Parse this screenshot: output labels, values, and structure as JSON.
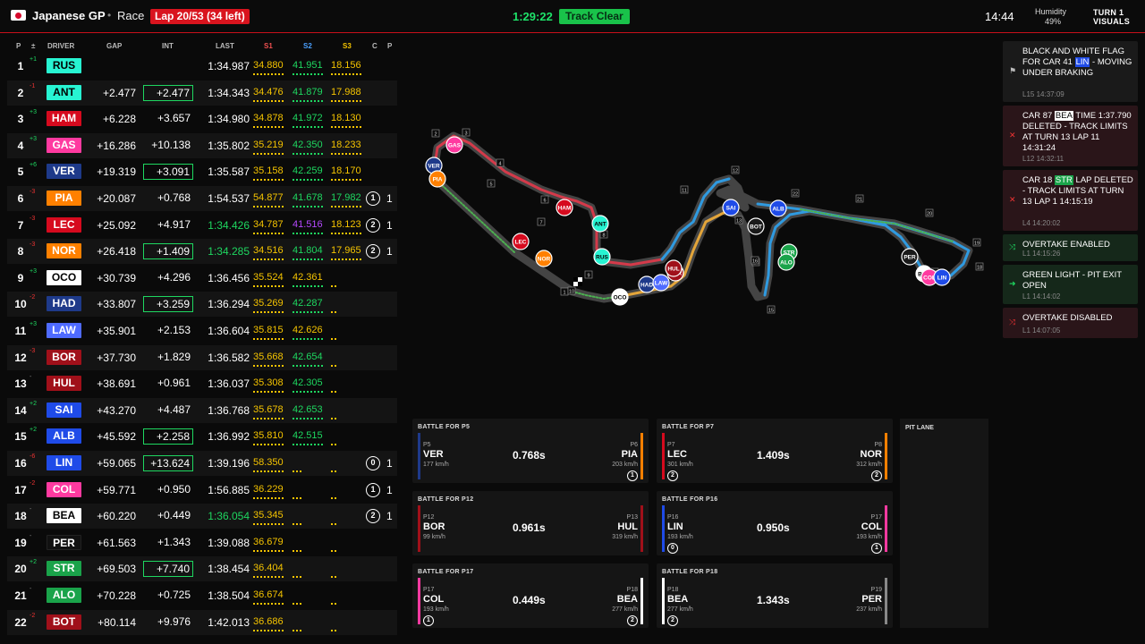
{
  "header": {
    "gp": "Japanese GP",
    "session": "Race",
    "lap": "Lap 20/53 (34 left)",
    "clock": "1:29:22",
    "track_status": "Track Clear",
    "local_time": "14:44",
    "humidity_label": "Humidity",
    "humidity_value": "49%",
    "brand_line1": "TURN 1",
    "brand_line2": "VISUALS"
  },
  "tower_headers": {
    "p": "P",
    "chg": "±",
    "driver": "DRIVER",
    "gap": "GAP",
    "int": "INT",
    "last": "LAST",
    "s1": "S1",
    "s2": "S2",
    "s3": "S3",
    "c": "C",
    "pit": "P"
  },
  "drivers": [
    {
      "pos": "1",
      "chg": "+1",
      "code": "RUS",
      "color": "#27f4d2",
      "text": "#000",
      "gap": "",
      "int": "",
      "int_box": false,
      "last": "1:34.987",
      "last_color": "#fff",
      "s1": "34.880",
      "s2": "41.951",
      "s3": "18.156",
      "s1c": "#f5c400",
      "s2c": "#1ed760",
      "s3c": "#f5c400",
      "pit": "",
      "pitc": ""
    },
    {
      "pos": "2",
      "chg": "-1",
      "code": "ANT",
      "color": "#27f4d2",
      "text": "#000",
      "gap": "+2.477",
      "int": "+2.477",
      "int_box": true,
      "last": "1:34.343",
      "last_color": "#fff",
      "s1": "34.476",
      "s2": "41.879",
      "s3": "17.988",
      "s1c": "#f5c400",
      "s2c": "#1ed760",
      "s3c": "#f5c400",
      "pit": "",
      "pitc": ""
    },
    {
      "pos": "3",
      "chg": "+3",
      "code": "HAM",
      "color": "#d60a1e",
      "text": "#fff",
      "gap": "+6.228",
      "int": "+3.657",
      "int_box": false,
      "last": "1:34.980",
      "last_color": "#fff",
      "s1": "34.878",
      "s2": "41.972",
      "s3": "18.130",
      "s1c": "#f5c400",
      "s2c": "#1ed760",
      "s3c": "#f5c400",
      "pit": "",
      "pitc": ""
    },
    {
      "pos": "4",
      "chg": "+3",
      "code": "GAS",
      "color": "#ff3aa0",
      "text": "#fff",
      "gap": "+16.286",
      "int": "+10.138",
      "int_box": false,
      "last": "1:35.802",
      "last_color": "#fff",
      "s1": "35.219",
      "s2": "42.350",
      "s3": "18.233",
      "s1c": "#f5c400",
      "s2c": "#1ed760",
      "s3c": "#f5c400",
      "pit": "",
      "pitc": ""
    },
    {
      "pos": "5",
      "chg": "+6",
      "code": "VER",
      "color": "#1e3a8a",
      "text": "#fff",
      "gap": "+19.319",
      "int": "+3.091",
      "int_box": true,
      "last": "1:35.587",
      "last_color": "#fff",
      "s1": "35.158",
      "s2": "42.259",
      "s3": "18.170",
      "s1c": "#f5c400",
      "s2c": "#1ed760",
      "s3c": "#f5c400",
      "pit": "",
      "pitc": ""
    },
    {
      "pos": "6",
      "chg": "-3",
      "code": "PIA",
      "color": "#ff8000",
      "text": "#fff",
      "gap": "+20.087",
      "int": "+0.768",
      "int_box": false,
      "last": "1:54.537",
      "last_color": "#fff",
      "s1": "54.877",
      "s2": "41.678",
      "s3": "17.982",
      "s1c": "#f5c400",
      "s2c": "#1ed760",
      "s3c": "#1ed760",
      "pit": "1",
      "pitc": "1"
    },
    {
      "pos": "7",
      "chg": "-3",
      "code": "LEC",
      "color": "#d60a1e",
      "text": "#fff",
      "gap": "+25.092",
      "int": "+4.917",
      "int_box": false,
      "last": "1:34.426",
      "last_color": "#1ed760",
      "s1": "34.787",
      "s2": "41.516",
      "s3": "18.123",
      "s1c": "#f5c400",
      "s2c": "#b548ff",
      "s3c": "#f5c400",
      "pit": "2",
      "pitc": "1"
    },
    {
      "pos": "8",
      "chg": "-3",
      "code": "NOR",
      "color": "#ff8000",
      "text": "#fff",
      "gap": "+26.418",
      "int": "+1.409",
      "int_box": true,
      "last": "1:34.285",
      "last_color": "#1ed760",
      "s1": "34.516",
      "s2": "41.804",
      "s3": "17.965",
      "s1c": "#f5c400",
      "s2c": "#1ed760",
      "s3c": "#f5c400",
      "pit": "2",
      "pitc": "1"
    },
    {
      "pos": "9",
      "chg": "+3",
      "code": "OCO",
      "color": "#ffffff",
      "text": "#000",
      "gap": "+30.739",
      "int": "+4.296",
      "int_box": false,
      "last": "1:36.456",
      "last_color": "#fff",
      "s1": "35.524",
      "s2": "42.361",
      "s3": "",
      "s1c": "#f5c400",
      "s2c": "#f5c400",
      "s3c": "#f5c400",
      "pit": "",
      "pitc": ""
    },
    {
      "pos": "10",
      "chg": "-2",
      "code": "HAD",
      "color": "#1e3a8a",
      "text": "#fff",
      "gap": "+33.807",
      "int": "+3.259",
      "int_box": true,
      "last": "1:36.294",
      "last_color": "#fff",
      "s1": "35.269",
      "s2": "42.287",
      "s3": "",
      "s1c": "#f5c400",
      "s2c": "#1ed760",
      "s3c": "#f5c400",
      "pit": "",
      "pitc": ""
    },
    {
      "pos": "11",
      "chg": "+3",
      "code": "LAW",
      "color": "#4f6bff",
      "text": "#fff",
      "gap": "+35.901",
      "int": "+2.153",
      "int_box": false,
      "last": "1:36.604",
      "last_color": "#fff",
      "s1": "35.815",
      "s2": "42.626",
      "s3": "",
      "s1c": "#f5c400",
      "s2c": "#f5c400",
      "s3c": "#f5c400",
      "pit": "",
      "pitc": ""
    },
    {
      "pos": "12",
      "chg": "-3",
      "code": "BOR",
      "color": "#a0101a",
      "text": "#fff",
      "gap": "+37.730",
      "int": "+1.829",
      "int_box": false,
      "last": "1:36.582",
      "last_color": "#fff",
      "s1": "35.668",
      "s2": "42.654",
      "s3": "",
      "s1c": "#f5c400",
      "s2c": "#1ed760",
      "s3c": "#f5c400",
      "pit": "",
      "pitc": ""
    },
    {
      "pos": "13",
      "chg": "-",
      "code": "HUL",
      "color": "#a0101a",
      "text": "#fff",
      "gap": "+38.691",
      "int": "+0.961",
      "int_box": false,
      "last": "1:36.037",
      "last_color": "#fff",
      "s1": "35.308",
      "s2": "42.305",
      "s3": "",
      "s1c": "#f5c400",
      "s2c": "#1ed760",
      "s3c": "#f5c400",
      "pit": "",
      "pitc": ""
    },
    {
      "pos": "14",
      "chg": "+2",
      "code": "SAI",
      "color": "#1f4be8",
      "text": "#fff",
      "gap": "+43.270",
      "int": "+4.487",
      "int_box": false,
      "last": "1:36.768",
      "last_color": "#fff",
      "s1": "35.678",
      "s2": "42.653",
      "s3": "",
      "s1c": "#f5c400",
      "s2c": "#1ed760",
      "s3c": "#f5c400",
      "pit": "",
      "pitc": ""
    },
    {
      "pos": "15",
      "chg": "+2",
      "code": "ALB",
      "color": "#1f4be8",
      "text": "#fff",
      "gap": "+45.592",
      "int": "+2.258",
      "int_box": true,
      "last": "1:36.992",
      "last_color": "#fff",
      "s1": "35.810",
      "s2": "42.515",
      "s3": "",
      "s1c": "#f5c400",
      "s2c": "#1ed760",
      "s3c": "#f5c400",
      "pit": "",
      "pitc": ""
    },
    {
      "pos": "16",
      "chg": "-6",
      "code": "LIN",
      "color": "#1f4be8",
      "text": "#fff",
      "gap": "+59.065",
      "int": "+13.624",
      "int_box": true,
      "last": "1:39.196",
      "last_color": "#fff",
      "s1": "58.350",
      "s2": "",
      "s3": "",
      "s1c": "#f5c400",
      "s2c": "#1ed760",
      "s3c": "#f5c400",
      "pit": "0",
      "pitc": "1"
    },
    {
      "pos": "17",
      "chg": "-2",
      "code": "COL",
      "color": "#ff3aa0",
      "text": "#fff",
      "gap": "+59.771",
      "int": "+0.950",
      "int_box": false,
      "last": "1:56.885",
      "last_color": "#fff",
      "s1": "36.229",
      "s2": "",
      "s3": "",
      "s1c": "#f5c400",
      "s2c": "#1ed760",
      "s3c": "#f5c400",
      "pit": "1",
      "pitc": "1"
    },
    {
      "pos": "18",
      "chg": "-",
      "code": "BEA",
      "color": "#ffffff",
      "text": "#000",
      "gap": "+60.220",
      "int": "+0.449",
      "int_box": false,
      "last": "1:36.054",
      "last_color": "#1ed760",
      "s1": "35.345",
      "s2": "",
      "s3": "",
      "s1c": "#f5c400",
      "s2c": "#1ed760",
      "s3c": "#f5c400",
      "pit": "2",
      "pitc": "1"
    },
    {
      "pos": "19",
      "chg": "-",
      "code": "PER",
      "color": "#111111",
      "text": "#fff",
      "gap": "+61.563",
      "int": "+1.343",
      "int_box": false,
      "last": "1:39.088",
      "last_color": "#fff",
      "s1": "36.679",
      "s2": "",
      "s3": "",
      "s1c": "#f5c400",
      "s2c": "#1ed760",
      "s3c": "#f5c400",
      "pit": "",
      "pitc": ""
    },
    {
      "pos": "20",
      "chg": "+2",
      "code": "STR",
      "color": "#1aa34a",
      "text": "#fff",
      "gap": "+69.503",
      "int": "+7.740",
      "int_box": true,
      "last": "1:38.454",
      "last_color": "#fff",
      "s1": "36.404",
      "s2": "",
      "s3": "",
      "s1c": "#f5c400",
      "s2c": "#1ed760",
      "s3c": "#f5c400",
      "pit": "",
      "pitc": ""
    },
    {
      "pos": "21",
      "chg": "-",
      "code": "ALO",
      "color": "#1aa34a",
      "text": "#fff",
      "gap": "+70.228",
      "int": "+0.725",
      "int_box": false,
      "last": "1:38.504",
      "last_color": "#fff",
      "s1": "36.674",
      "s2": "",
      "s3": "",
      "s1c": "#f5c400",
      "s2c": "#1ed760",
      "s3c": "#f5c400",
      "pit": "",
      "pitc": ""
    },
    {
      "pos": "22",
      "chg": "-2",
      "code": "BOT",
      "color": "#a0101a",
      "text": "#fff",
      "gap": "+80.114",
      "int": "+9.976",
      "int_box": false,
      "last": "1:42.013",
      "last_color": "#fff",
      "s1": "36.686",
      "s2": "",
      "s3": "",
      "s1c": "#f5c400",
      "s2c": "#1ed760",
      "s3c": "#f5c400",
      "pit": "",
      "pitc": ""
    }
  ],
  "race_control": [
    {
      "icon": "flag-icon",
      "glyph": "⚑",
      "tone": "neutral",
      "msg_a": "BLACK AND WHITE FLAG FOR CAR 41 ",
      "tag": "LIN",
      "tag_color": "#1f4be8",
      "msg_b": " - MOVING UNDER BRAKING",
      "sub": "L15 14:37:09"
    },
    {
      "icon": "cross-icon",
      "glyph": "✕",
      "tone": "red",
      "msg_a": "CAR 87 ",
      "tag": "BEA",
      "tag_color": "#ffffff",
      "msg_b": " TIME 1:37.790 DELETED - TRACK LIMITS AT TURN 13 LAP 11 14:31:24",
      "sub": "L12 14:32:11"
    },
    {
      "icon": "cross-icon",
      "glyph": "✕",
      "tone": "red",
      "msg_a": "CAR 18 ",
      "tag": "STR",
      "tag_color": "#1aa34a",
      "msg_b": " LAP DELETED - TRACK LIMITS AT TURN 13 LAP 1 14:15:19",
      "sub": "L4 14:20:02"
    },
    {
      "icon": "overtake-icon",
      "glyph": "⤨",
      "tone": "green",
      "msg_a": "OVERTAKE ENABLED",
      "tag": "",
      "tag_color": "",
      "msg_b": "",
      "sub": "L1 14:15:26"
    },
    {
      "icon": "pit-exit-icon",
      "glyph": "➜",
      "tone": "green",
      "msg_a": "GREEN LIGHT - PIT EXIT OPEN",
      "tag": "",
      "tag_color": "",
      "msg_b": "",
      "sub": "L1 14:14:02"
    },
    {
      "icon": "overtake-icon",
      "glyph": "⤨",
      "tone": "red",
      "msg_a": "OVERTAKE DISABLED",
      "tag": "",
      "tag_color": "",
      "msg_b": "",
      "sub": "L1 14:07:05"
    }
  ],
  "battles": [
    {
      "title": "BATTLE FOR P5",
      "lp": "P5",
      "lc": "VER",
      "ls": "177 km/h",
      "lpit": "",
      "lcol": "#1e3a8a",
      "gap": "0.768s",
      "rp": "P6",
      "rc": "PIA",
      "rs": "203 km/h",
      "rpit": "1",
      "rcol": "#ff8000"
    },
    {
      "title": "BATTLE FOR P7",
      "lp": "P7",
      "lc": "LEC",
      "ls": "301 km/h",
      "lpit": "2",
      "lcol": "#d60a1e",
      "gap": "1.409s",
      "rp": "P8",
      "rc": "NOR",
      "rs": "312 km/h",
      "rpit": "2",
      "rcol": "#ff8000"
    },
    {
      "title": "BATTLE FOR P12",
      "lp": "P12",
      "lc": "BOR",
      "ls": "99 km/h",
      "lpit": "",
      "lcol": "#a0101a",
      "gap": "0.961s",
      "rp": "P13",
      "rc": "HUL",
      "rs": "319 km/h",
      "rpit": "",
      "rcol": "#a0101a"
    },
    {
      "title": "BATTLE FOR P16",
      "lp": "P16",
      "lc": "LIN",
      "ls": "193 km/h",
      "lpit": "0",
      "lcol": "#1f4be8",
      "gap": "0.950s",
      "rp": "P17",
      "rc": "COL",
      "rs": "193 km/h",
      "rpit": "1",
      "rcol": "#ff3aa0"
    },
    {
      "title": "BATTLE FOR P17",
      "lp": "P17",
      "lc": "COL",
      "ls": "193 km/h",
      "lpit": "1",
      "lcol": "#ff3aa0",
      "gap": "0.449s",
      "rp": "P18",
      "rc": "BEA",
      "rs": "277 km/h",
      "rpit": "2",
      "rcol": "#ffffff"
    },
    {
      "title": "BATTLE FOR P18",
      "lp": "P18",
      "lc": "BEA",
      "ls": "277 km/h",
      "lpit": "2",
      "lcol": "#ffffff",
      "gap": "1.343s",
      "rp": "P19",
      "rc": "PER",
      "rs": "237 km/h",
      "rpit": "",
      "rcol": "#888888"
    }
  ],
  "pit_lane": {
    "title": "PIT LANE"
  },
  "map": {
    "corner_labels": [
      "1",
      "2",
      "3",
      "4",
      "5",
      "6",
      "7",
      "8",
      "9",
      "10",
      "11",
      "12",
      "13",
      "14",
      "15",
      "16",
      "17",
      "18",
      "19",
      "20",
      "21",
      "22"
    ],
    "cars": [
      {
        "code": "GAS",
        "color": "#ff3aa0"
      },
      {
        "code": "VER",
        "color": "#1e3a8a"
      },
      {
        "code": "PIA",
        "color": "#ff8000"
      },
      {
        "code": "HAM",
        "color": "#d60a1e"
      },
      {
        "code": "ANT",
        "color": "#27f4d2"
      },
      {
        "code": "RUS",
        "color": "#27f4d2"
      },
      {
        "code": "LEC",
        "color": "#d60a1e"
      },
      {
        "code": "NOR",
        "color": "#ff8000"
      },
      {
        "code": "OCO",
        "color": "#ffffff"
      },
      {
        "code": "HAD",
        "color": "#1e3a8a"
      },
      {
        "code": "LAW",
        "color": "#4f6bff"
      },
      {
        "code": "BOR",
        "color": "#a0101a"
      },
      {
        "code": "HUL",
        "color": "#a0101a"
      },
      {
        "code": "SAI",
        "color": "#1f4be8"
      },
      {
        "code": "ALB",
        "color": "#1f4be8"
      },
      {
        "code": "BOT",
        "color": "#1a1a1a"
      },
      {
        "code": "STR",
        "color": "#1aa34a"
      },
      {
        "code": "ALO",
        "color": "#1aa34a"
      },
      {
        "code": "PER",
        "color": "#1a1a1a"
      },
      {
        "code": "BEA",
        "color": "#ffffff"
      },
      {
        "code": "COL",
        "color": "#ff3aa0"
      },
      {
        "code": "LIN",
        "color": "#1f4be8"
      }
    ]
  }
}
